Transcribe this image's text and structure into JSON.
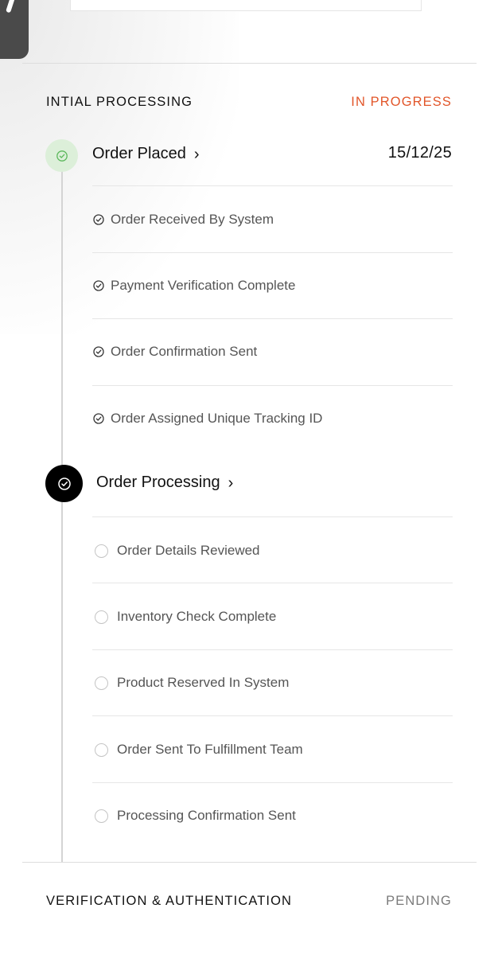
{
  "sections": [
    {
      "title": "INTIAL PROCESSING",
      "status": "IN PROGRESS"
    },
    {
      "title": "VERIFICATION & AUTHENTICATION",
      "status": "PENDING"
    }
  ],
  "stages": [
    {
      "title": "Order Placed",
      "date": "15/12/25",
      "state": "completed",
      "steps": [
        "Order Received By System",
        "Payment Verification Complete",
        "Order Confirmation Sent",
        "Order Assigned Unique Tracking ID"
      ]
    },
    {
      "title": "Order Processing",
      "state": "current",
      "steps": [
        "Order Details Reviewed",
        "Inventory Check Complete",
        "Product Reserved In System",
        "Order Sent To Fulfillment Team",
        "Processing Confirmation Sent"
      ]
    }
  ],
  "colors": {
    "in_progress": "#e2562a",
    "pending": "#7a7a7a",
    "completed_node_bg": "#dcefd9",
    "completed_node_icon": "#5cb85c",
    "current_node_bg": "#000000"
  },
  "icons": {
    "completed_step": "check-circle-icon",
    "pending_step": "empty-circle-icon",
    "stage_chevron": "chevron-right-icon"
  }
}
